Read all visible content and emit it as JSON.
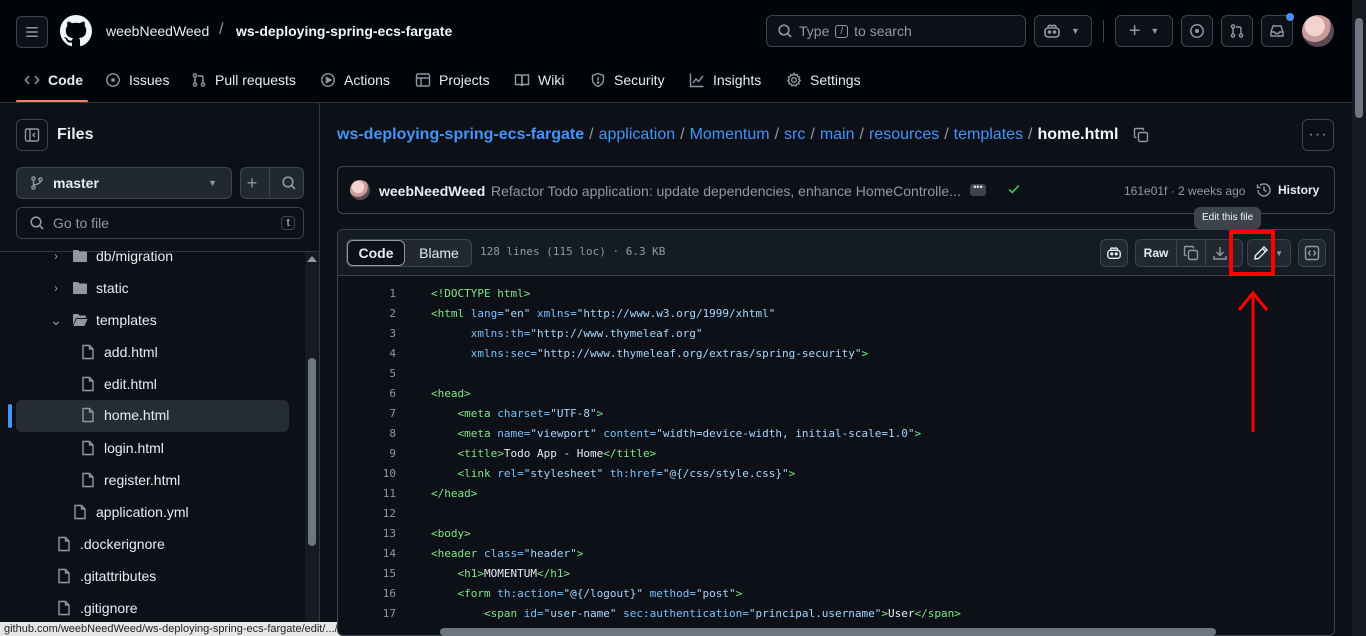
{
  "header": {
    "owner": "weebNeedWeed",
    "slash": "/",
    "repo": "ws-deploying-spring-ecs-fargate",
    "search_prefix": "Type",
    "search_key": "/",
    "search_suffix": "to search"
  },
  "tabs": [
    {
      "label": "Code",
      "icon": "code-icon"
    },
    {
      "label": "Issues",
      "icon": "issue-icon"
    },
    {
      "label": "Pull requests",
      "icon": "pull-request-icon"
    },
    {
      "label": "Actions",
      "icon": "play-icon"
    },
    {
      "label": "Projects",
      "icon": "table-icon"
    },
    {
      "label": "Wiki",
      "icon": "book-icon"
    },
    {
      "label": "Security",
      "icon": "shield-icon"
    },
    {
      "label": "Insights",
      "icon": "graph-icon"
    },
    {
      "label": "Settings",
      "icon": "gear-icon"
    }
  ],
  "sidebar": {
    "title": "Files",
    "branch": "master",
    "goto_placeholder": "Go to file",
    "goto_shortcut": "t",
    "tree": [
      {
        "label": "db/migration",
        "type": "folder",
        "expand": "›"
      },
      {
        "label": "static",
        "type": "folder",
        "expand": "›"
      },
      {
        "label": "templates",
        "type": "folder",
        "expand": "⌄"
      },
      {
        "label": "add.html",
        "type": "file"
      },
      {
        "label": "edit.html",
        "type": "file"
      },
      {
        "label": "home.html",
        "type": "file",
        "selected": true
      },
      {
        "label": "login.html",
        "type": "file"
      },
      {
        "label": "register.html",
        "type": "file"
      },
      {
        "label": "application.yml",
        "type": "file"
      },
      {
        "label": ".dockerignore",
        "type": "file"
      },
      {
        "label": ".gitattributes",
        "type": "file"
      },
      {
        "label": ".gitignore",
        "type": "file"
      }
    ]
  },
  "breadcrumb": {
    "parts": [
      "ws-deploying-spring-ecs-fargate",
      "application",
      "Momentum",
      "src",
      "main",
      "resources",
      "templates"
    ],
    "separator": "/",
    "current": "home.html"
  },
  "commit": {
    "author": "weebNeedWeed",
    "message": "Refactor Todo application: update dependencies, enhance HomeControlle...",
    "sha_time": "161e01f · 2 weeks ago",
    "history_label": "History"
  },
  "file_header": {
    "code_tab": "Code",
    "blame_tab": "Blame",
    "info": "128 lines (115 loc) · 6.3 KB",
    "raw_label": "Raw",
    "tooltip": "Edit this file"
  },
  "code_lines": [
    "1",
    "2",
    "3",
    "4",
    "5",
    "6",
    "7",
    "8",
    "9",
    "10",
    "11",
    "12",
    "13",
    "14",
    "15",
    "16",
    "17"
  ],
  "code_text": {
    "l1a": "<!DOCTYPE html>",
    "l2a": "<html ",
    "l2b": "lang=",
    "l2c": "\"en\"",
    "l2d": " xmlns=",
    "l2e": "\"http://www.w3.org/1999/xhtml\"",
    "l3a": "      xmlns:th=",
    "l3b": "\"http://www.thymeleaf.org\"",
    "l4a": "      xmlns:sec=",
    "l4b": "\"http://www.thymeleaf.org/extras/spring-security\"",
    "l4c": ">",
    "l6a": "<head>",
    "l7a": "    <meta ",
    "l7b": "charset=",
    "l7c": "\"UTF-8\"",
    "l7d": ">",
    "l8a": "    <meta ",
    "l8b": "name=",
    "l8c": "\"viewport\"",
    "l8d": " content=",
    "l8e": "\"width=device-width, initial-scale=1.0\"",
    "l8f": ">",
    "l9a": "    <title>",
    "l9b": "Todo App - Home",
    "l9c": "</title>",
    "l10a": "    <link ",
    "l10b": "rel=",
    "l10c": "\"stylesheet\"",
    "l10d": " th:href=",
    "l10e": "\"@{/css/style.css}\"",
    "l10f": ">",
    "l11a": "</head>",
    "l13a": "<body>",
    "l14a": "<header ",
    "l14b": "class=",
    "l14c": "\"header\"",
    "l14d": ">",
    "l15a": "    <h1>",
    "l15b": "MOMENTUM",
    "l15c": "</h1>",
    "l16a": "    <form ",
    "l16b": "th:action=",
    "l16c": "\"@{/logout}\"",
    "l16d": " method=",
    "l16e": "\"post\"",
    "l16f": ">",
    "l17a": "        <span ",
    "l17b": "id=",
    "l17c": "\"user-name\"",
    "l17d": " sec:authentication=",
    "l17e": "\"principal.username\"",
    "l17f": ">",
    "l17g": "User",
    "l17h": "</span>"
  },
  "status_url": "github.com/weebNeedWeed/ws-deploying-spring-ecs-fargate/edit/.../home.html",
  "colors": {
    "accent": "#4493f8",
    "highlight": "#ff0000",
    "success": "#3fb950"
  }
}
